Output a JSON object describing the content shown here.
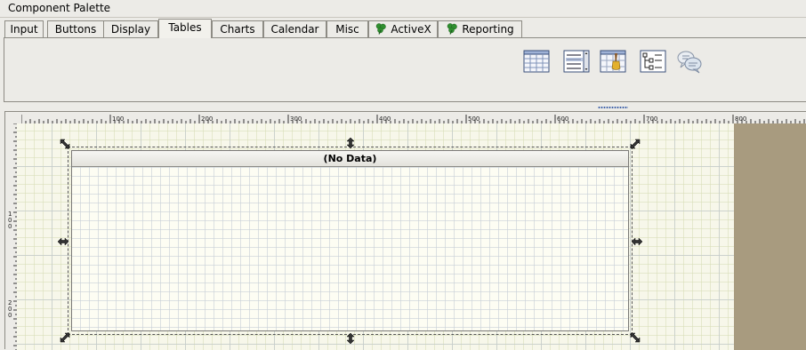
{
  "palette": {
    "title": "Component Palette",
    "tabs": [
      {
        "label": "Input",
        "active": false
      },
      {
        "label": "Buttons",
        "active": false
      },
      {
        "label": "Display",
        "active": false
      },
      {
        "label": "Tables",
        "active": true
      },
      {
        "label": "Charts",
        "active": false
      },
      {
        "label": "Calendar",
        "active": false
      },
      {
        "label": "Misc",
        "active": false
      },
      {
        "label": "ActiveX",
        "active": false,
        "icon": "clover-icon"
      },
      {
        "label": "Reporting",
        "active": false,
        "icon": "clover-icon"
      }
    ],
    "components": [
      {
        "name": "table-component-icon"
      },
      {
        "name": "list-component-icon"
      },
      {
        "name": "table-brush-icon"
      },
      {
        "name": "tree-view-icon"
      },
      {
        "name": "comment-bubbles-icon"
      }
    ]
  },
  "designer": {
    "ruler": {
      "horizontal_labels": [
        "100",
        "200",
        "300",
        "400",
        "500",
        "600",
        "700",
        "800"
      ],
      "vertical_labels": [
        "100",
        "200"
      ]
    },
    "table": {
      "header_text": "(No Data)"
    }
  },
  "colors": {
    "canvas_background": "#f7f7ea",
    "offcanvas": "#a89b7f",
    "grid_major": "#c4cbce",
    "clover": "#2f8f2f"
  }
}
